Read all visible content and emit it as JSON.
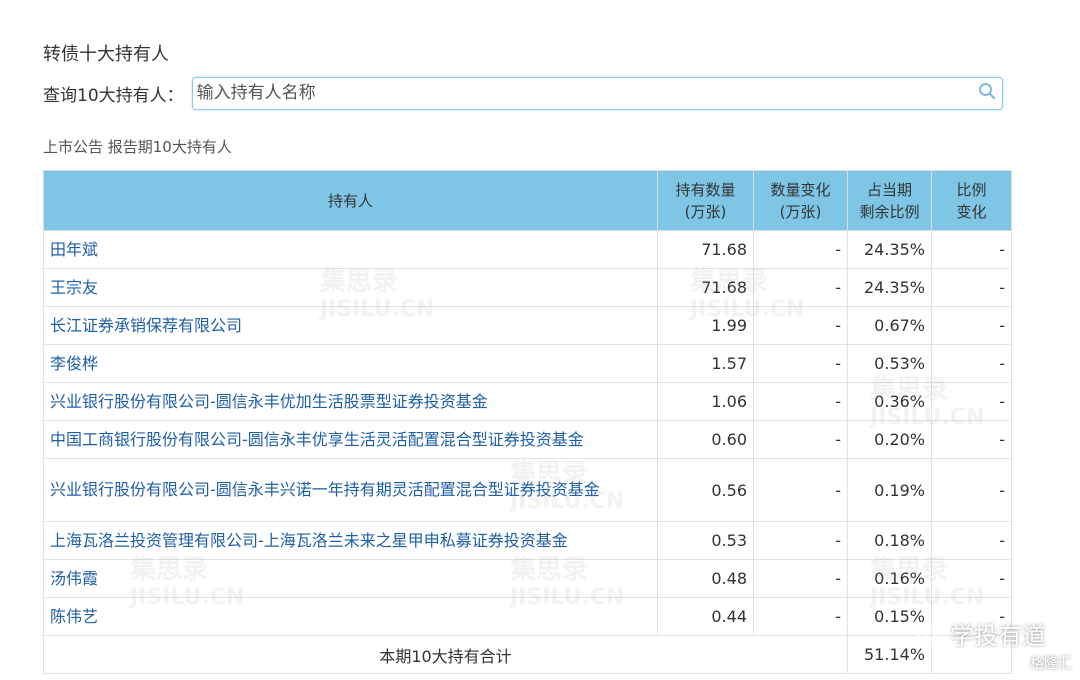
{
  "section_title": "转债十大持有人",
  "search": {
    "label": "查询10大持有人：",
    "placeholder": "输入持有人名称"
  },
  "sub_title": "上市公告 报告期10大持有人",
  "table": {
    "headers": {
      "holder": "持有人",
      "quantity_1": "持有数量",
      "quantity_2": "(万张)",
      "change_1": "数量变化",
      "change_2": "(万张)",
      "ratio_1": "占当期",
      "ratio_2": "剩余比例",
      "ratio_change_1": "比例",
      "ratio_change_2": "变化"
    },
    "rows": [
      {
        "holder": "田年斌",
        "quantity": "71.68",
        "change": "-",
        "ratio": "24.35%",
        "ratio_change": "-"
      },
      {
        "holder": "王宗友",
        "quantity": "71.68",
        "change": "-",
        "ratio": "24.35%",
        "ratio_change": "-"
      },
      {
        "holder": "长江证券承销保荐有限公司",
        "quantity": "1.99",
        "change": "-",
        "ratio": "0.67%",
        "ratio_change": "-"
      },
      {
        "holder": "李俊桦",
        "quantity": "1.57",
        "change": "-",
        "ratio": "0.53%",
        "ratio_change": "-"
      },
      {
        "holder": "兴业银行股份有限公司-圆信永丰优加生活股票型证券投资基金",
        "quantity": "1.06",
        "change": "-",
        "ratio": "0.36%",
        "ratio_change": "-"
      },
      {
        "holder": "中国工商银行股份有限公司-圆信永丰优享生活灵活配置混合型证券投资基金",
        "quantity": "0.60",
        "change": "-",
        "ratio": "0.20%",
        "ratio_change": "-"
      },
      {
        "holder": "兴业银行股份有限公司-圆信永丰兴诺一年持有期灵活配置混合型证券投资基金",
        "quantity": "0.56",
        "change": "-",
        "ratio": "0.19%",
        "ratio_change": "-"
      },
      {
        "holder": "上海瓦洛兰投资管理有限公司-上海瓦洛兰未来之星甲申私募证券投资基金",
        "quantity": "0.53",
        "change": "-",
        "ratio": "0.18%",
        "ratio_change": "-"
      },
      {
        "holder": "汤伟霞",
        "quantity": "0.48",
        "change": "-",
        "ratio": "0.16%",
        "ratio_change": "-"
      },
      {
        "holder": "陈伟艺",
        "quantity": "0.44",
        "change": "-",
        "ratio": "0.15%",
        "ratio_change": "-"
      }
    ],
    "total": {
      "label": "本期10大持有合计",
      "ratio": "51.14%"
    }
  },
  "watermark": {
    "text": "集思录",
    "sub": "JISILU.CN"
  },
  "brand": {
    "name": "学投有道",
    "logo_text": "格隆汇",
    "icon": "wechat-icon"
  },
  "colors": {
    "header_bg": "#7fc6e6",
    "link": "#1f5fa8",
    "search_border": "#8fc9e6"
  }
}
